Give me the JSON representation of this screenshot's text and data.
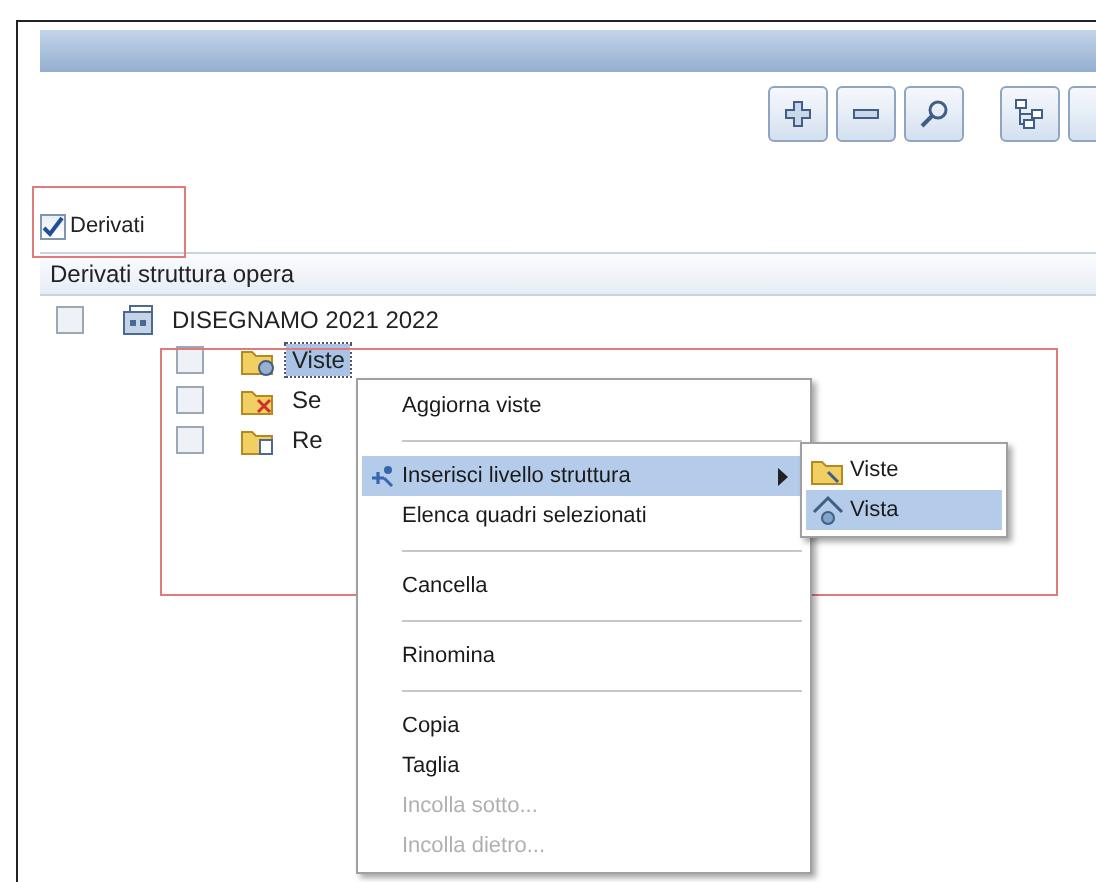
{
  "toolbar": {
    "buttons": [
      {
        "kind": "plus"
      },
      {
        "kind": "minus"
      },
      {
        "kind": "search"
      },
      {
        "kind": "tree"
      },
      {
        "kind": "blank"
      }
    ]
  },
  "filter": {
    "label": "Derivati",
    "checked": true
  },
  "tree": {
    "header": "Derivati struttura opera",
    "items": [
      {
        "label": "DISEGNAMO 2021 2022",
        "checked": false,
        "selected": false,
        "kind": "project",
        "children": [
          {
            "label": "Viste",
            "checked": false,
            "selected": true,
            "kind": "views"
          },
          {
            "label": "Se",
            "checked": false,
            "selected": false,
            "kind": "sections"
          },
          {
            "label": "Re",
            "checked": false,
            "selected": false,
            "kind": "reports"
          }
        ]
      }
    ]
  },
  "context_menu": {
    "items": [
      {
        "kind": "item",
        "label": "Aggiorna viste",
        "selected": false,
        "disabled": false
      },
      {
        "kind": "separator"
      },
      {
        "kind": "submenu",
        "label": "Inserisci livello struttura",
        "selected": true,
        "disabled": false
      },
      {
        "kind": "item",
        "label": "Elenca quadri selezionati",
        "selected": false,
        "disabled": false
      },
      {
        "kind": "separator"
      },
      {
        "kind": "item",
        "label": "Cancella",
        "selected": false,
        "disabled": false
      },
      {
        "kind": "separator"
      },
      {
        "kind": "item",
        "label": "Rinomina",
        "selected": false,
        "disabled": false
      },
      {
        "kind": "separator"
      },
      {
        "kind": "item",
        "label": "Copia",
        "selected": false,
        "disabled": false
      },
      {
        "kind": "item",
        "label": "Taglia",
        "selected": false,
        "disabled": false
      },
      {
        "kind": "item",
        "label": "Incolla sotto...",
        "selected": false,
        "disabled": true
      },
      {
        "kind": "item",
        "label": "Incolla dietro...",
        "selected": false,
        "disabled": true
      }
    ]
  },
  "submenu": {
    "items": [
      {
        "label": "Viste",
        "kind": "folder",
        "selected": false
      },
      {
        "label": "Vista",
        "kind": "view",
        "selected": true
      }
    ]
  }
}
